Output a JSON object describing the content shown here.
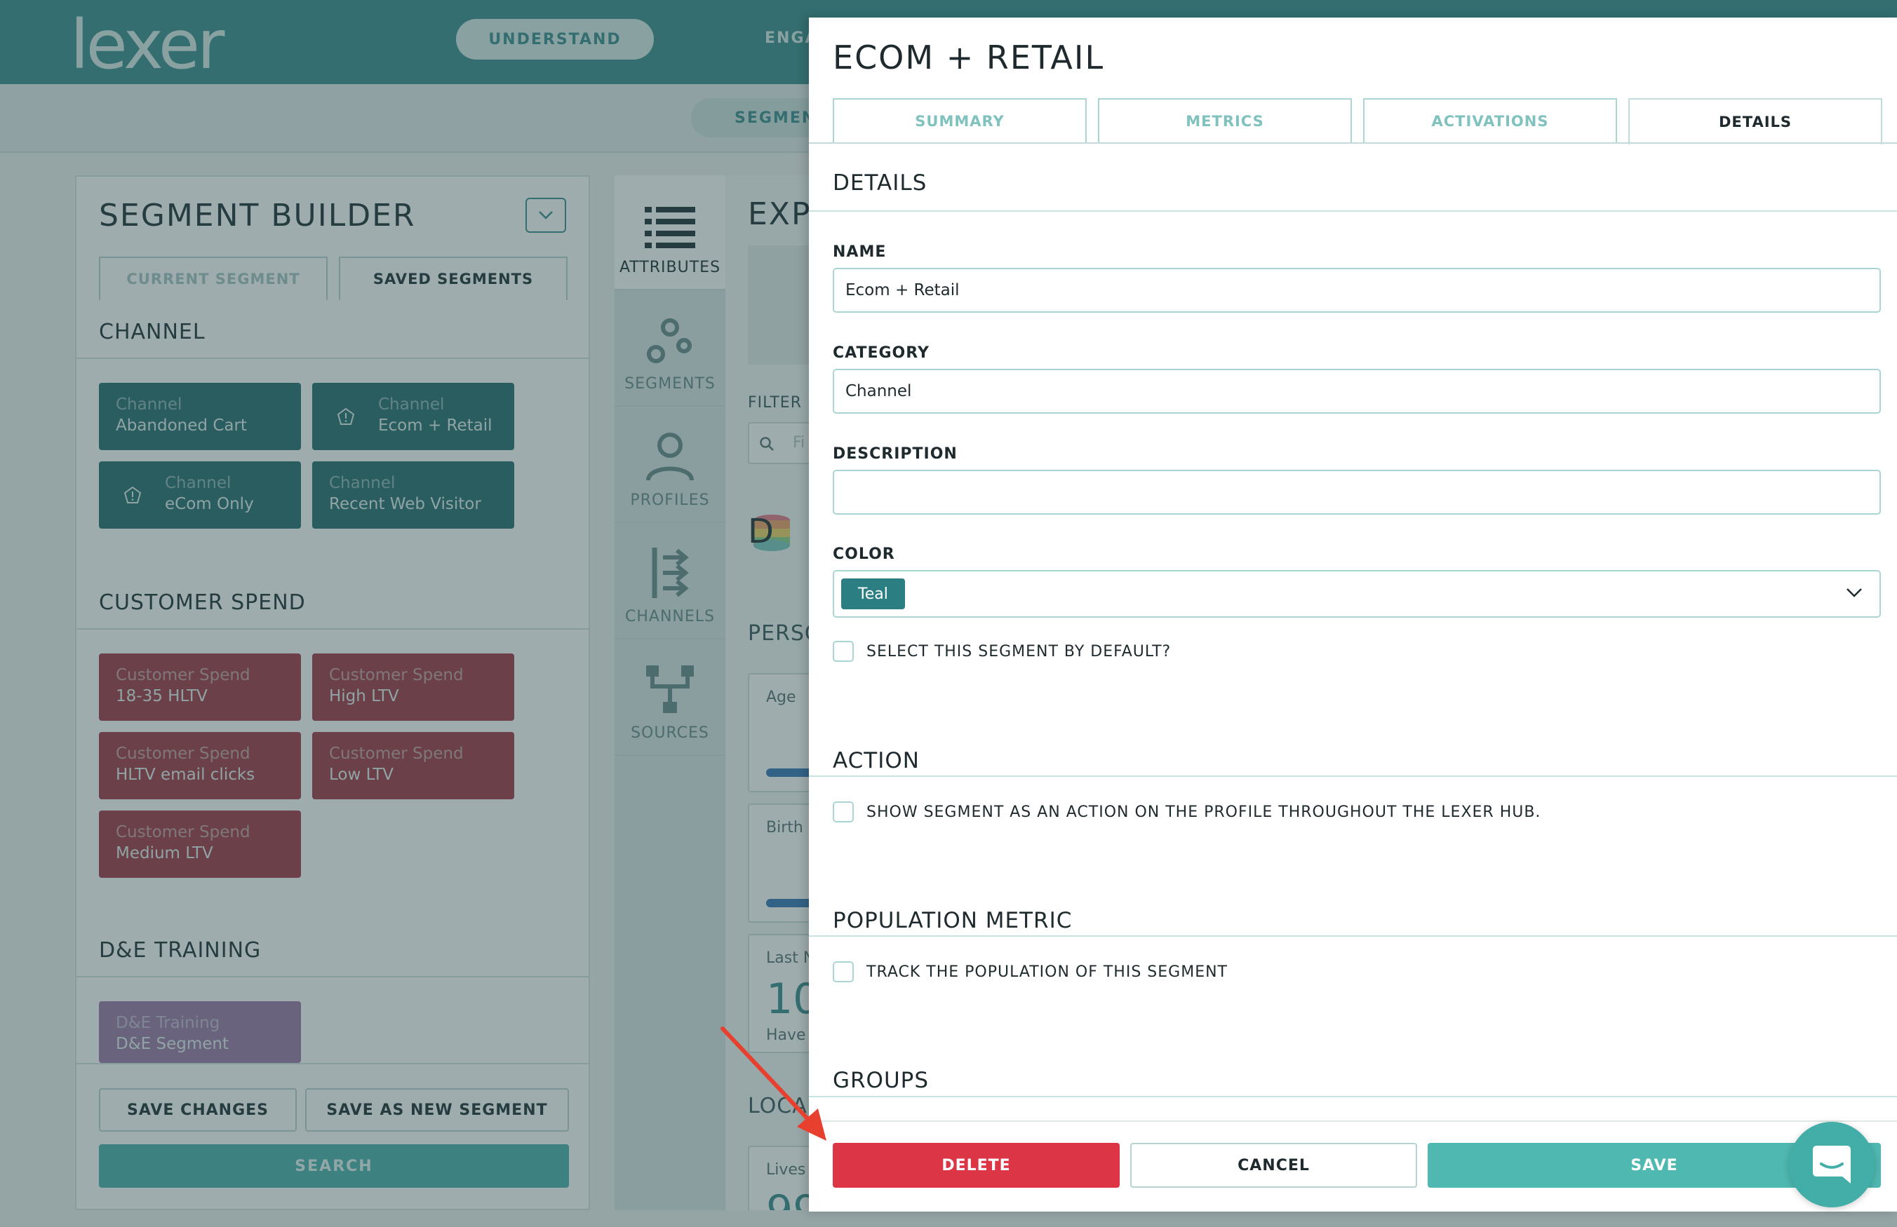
{
  "app": {
    "logo": "lexer",
    "nav": [
      "UNDERSTAND",
      "ENGA"
    ],
    "subnav": "SEGMENT"
  },
  "builder": {
    "title": "SEGMENT BUILDER",
    "tabs": [
      "CURRENT SEGMENT",
      "SAVED SEGMENTS"
    ],
    "sections": [
      {
        "title": "CHANNEL",
        "chips": [
          {
            "category": "Channel",
            "name": "Abandoned Cart"
          },
          {
            "category": "Channel",
            "name": "Ecom + Retail"
          },
          {
            "category": "Channel",
            "name": "eCom Only"
          },
          {
            "category": "Channel",
            "name": "Recent Web Visitor"
          }
        ]
      },
      {
        "title": "CUSTOMER SPEND",
        "chips": [
          {
            "category": "Customer Spend",
            "name": "18-35 HLTV"
          },
          {
            "category": "Customer Spend",
            "name": "High LTV"
          },
          {
            "category": "Customer Spend",
            "name": "HLTV email clicks"
          },
          {
            "category": "Customer Spend",
            "name": "Low LTV"
          },
          {
            "category": "Customer Spend",
            "name": "Medium LTV"
          }
        ]
      },
      {
        "title": "D&E TRAINING",
        "chips": [
          {
            "category": "D&E Training",
            "name": "D&E Segment"
          }
        ]
      }
    ],
    "save_changes": "SAVE CHANGES",
    "save_new": "SAVE AS NEW SEGMENT",
    "search": "SEARCH"
  },
  "sidenav": {
    "items": [
      "ATTRIBUTES",
      "SEGMENTS",
      "PROFILES",
      "CHANNELS",
      "SOURCES"
    ]
  },
  "explore": {
    "title": "EXP",
    "filter": "FILTER",
    "search_placeholder": "Fi",
    "data_letter": "D",
    "section": "PERSO",
    "cards": [
      "Age",
      "Birth",
      "Last N"
    ],
    "big_number": "10",
    "have": "Have",
    "section2": "LOCA",
    "lives": "Lives",
    "lives_number": "99"
  },
  "modal": {
    "title": "ECOM + RETAIL",
    "tabs": [
      "SUMMARY",
      "METRICS",
      "ACTIVATIONS",
      "DETAILS"
    ],
    "details_heading": "DETAILS",
    "name_label": "NAME",
    "name_value": "Ecom + Retail",
    "category_label": "CATEGORY",
    "category_value": "Channel",
    "description_label": "DESCRIPTION",
    "description_value": "",
    "color_label": "COLOR",
    "color_value": "Teal",
    "default_checkbox": "SELECT THIS SEGMENT BY DEFAULT?",
    "action_heading": "ACTION",
    "action_checkbox": "SHOW SEGMENT AS AN ACTION ON THE PROFILE THROUGHOUT THE LEXER HUB.",
    "population_heading": "POPULATION METRIC",
    "population_checkbox": "TRACK THE POPULATION OF THIS SEGMENT",
    "groups_heading": "GROUPS",
    "delete": "DELETE",
    "cancel": "CANCEL",
    "save": "SAVE"
  },
  "colors": {
    "brand_teal": "#3f8f90",
    "delete_red": "#dc3545",
    "save_teal": "#4fb8b1",
    "chip_teal": "#2b6f72",
    "chip_red": "#a33b47",
    "chip_purple": "#a07aa8"
  },
  "icons": {
    "chat": "chat-bubble-icon",
    "dropdown": "chevron-down-icon"
  }
}
